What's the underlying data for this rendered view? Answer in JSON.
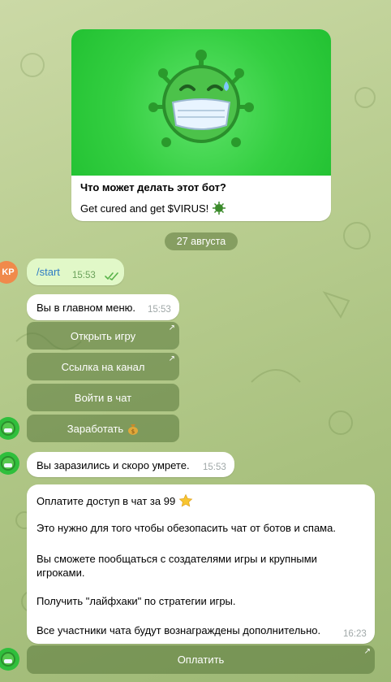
{
  "bot_intro": {
    "title": "Что может делать этот бот?",
    "text": "Get cured and get $VIRUS!",
    "image_icon": "virus-mascot-icon",
    "accent": "#3fd44c"
  },
  "date_separator": "27 августа",
  "messages": {
    "user_start": {
      "avatar": "KP",
      "text": "/start",
      "time": "15:53",
      "status_icon": "double-check-icon"
    },
    "menu": {
      "text": "Вы в главном меню.",
      "time": "15:53"
    },
    "infected": {
      "text": "Вы заразились и скоро умрете.",
      "time": "15:53"
    },
    "pay_info": {
      "line1": "Оплатите доступ в чат за 99",
      "line2": "Это нужно для того чтобы обезопасить чат от ботов и спама.",
      "line3": "Вы сможете пообщаться с создателями игры и крупными игроками.",
      "line4": "Получить \"лайфхаки\" по стратегии игры.",
      "line5": "Все участники чата будут вознаграждены дополнительно.",
      "time": "16:23"
    }
  },
  "keyboard": {
    "open_game": "Открыть игру",
    "channel_link": "Ссылка на канал",
    "join_chat": "Войти в чат",
    "earn": "Заработать",
    "pay": "Оплатить"
  },
  "colors": {
    "user_bubble": "#e1f8c8",
    "keyboard_button": "#6a8c48",
    "link": "#2d7bc4"
  }
}
